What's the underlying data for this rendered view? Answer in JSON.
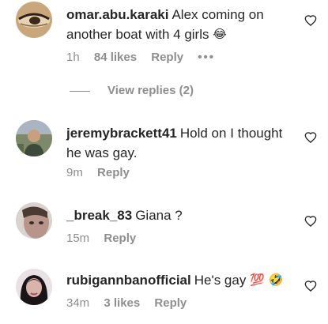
{
  "comments": [
    {
      "username": "omar.abu.karaki",
      "text": "Alex coming on another boat with 4 girls",
      "emoji": "😂",
      "time": "1h",
      "likes": "84 likes",
      "reply_label": "Reply",
      "more": "•••",
      "avatar": "avatar-eye-closeup"
    },
    {
      "username": "jeremybrackett41",
      "text": "Hold on I thought he was gay.",
      "time": "9m",
      "reply_label": "Reply",
      "avatar": "avatar-man-outdoors"
    },
    {
      "username": "_break_83",
      "text": "Giana ?",
      "time": "15m",
      "reply_label": "Reply",
      "avatar": "avatar-face-closeup"
    },
    {
      "username": "rubigannbanofficial",
      "text": "He's gay",
      "emoji": "💯 🤣",
      "time": "34m",
      "likes": "3 likes",
      "reply_label": "Reply",
      "avatar": "avatar-woman-dark-hair"
    }
  ],
  "view_replies": "View replies (2)",
  "icons": {
    "like": "heart-outline-icon"
  },
  "colors": {
    "text": "#262626",
    "secondary": "#8e8e8e"
  }
}
